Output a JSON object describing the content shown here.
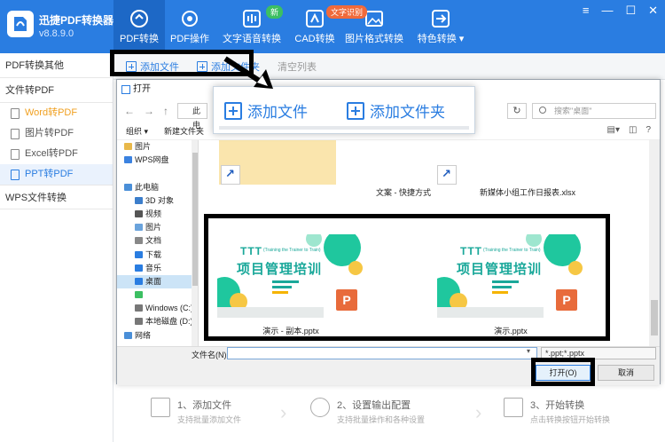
{
  "app": {
    "title": "迅捷PDF转换器",
    "version": "v8.8.9.0"
  },
  "nav": [
    {
      "label": "PDF转换",
      "icon": "refresh-icon"
    },
    {
      "label": "PDF操作",
      "icon": "gear-icon"
    },
    {
      "label": "文字语音转换",
      "icon": "soundwave-icon"
    },
    {
      "label": "CAD转换",
      "icon": "cad-icon"
    },
    {
      "label": "图片格式转换",
      "icon": "image-icon"
    },
    {
      "label": "特色转换",
      "icon": "special-convert-icon"
    }
  ],
  "badges": {
    "new": "新",
    "trial": "文字识别"
  },
  "sidebar": {
    "group1": "PDF转换其他",
    "group2": "文件转PDF",
    "items": [
      "Word转PDF",
      "图片转PDF",
      "Excel转PDF",
      "PPT转PDF"
    ],
    "group3": "WPS文件转换"
  },
  "toolbar": {
    "add_file": "添加文件",
    "add_folder": "添加文件夹",
    "clear": "清空列表"
  },
  "dialog": {
    "title": "打开",
    "path": "此电",
    "search_placeholder": "搜索\"桌面\"",
    "organize": "组织 ▾",
    "new_folder": "新建文件夹",
    "tree": [
      {
        "label": "图片",
        "indent": false,
        "color": "#e8b84a"
      },
      {
        "label": "WPS网盘",
        "indent": false,
        "color": "#3b82e0"
      },
      {
        "label": "",
        "indent": false,
        "color": ""
      },
      {
        "label": "此电脑",
        "indent": false,
        "color": "#4a8fd8"
      },
      {
        "label": "3D 对象",
        "indent": true,
        "color": "#3c7ecb"
      },
      {
        "label": "视频",
        "indent": true,
        "color": "#555"
      },
      {
        "label": "图片",
        "indent": true,
        "color": "#6aa3dc"
      },
      {
        "label": "文档",
        "indent": true,
        "color": "#888"
      },
      {
        "label": "下载",
        "indent": true,
        "color": "#2a7de1"
      },
      {
        "label": "音乐",
        "indent": true,
        "color": "#2a7de1"
      },
      {
        "label": "桌面",
        "indent": true,
        "color": "#2a7de1",
        "selected": true
      },
      {
        "label": "",
        "indent": true,
        "color": "#3cbf62"
      },
      {
        "label": "Windows (C:)",
        "indent": true,
        "color": "#777"
      },
      {
        "label": "本地磁盘 (D:)",
        "indent": true,
        "color": "#777"
      },
      {
        "label": "网络",
        "indent": false,
        "color": "#4a8fd8"
      }
    ],
    "files_top": [
      "文案 - 快捷方式",
      "新媒体小组工作日报表.xlsx"
    ],
    "files_ppt": [
      "演示 - 副本.pptx",
      "演示.pptx"
    ],
    "filename_label": "文件名(N):",
    "filename_value": "",
    "filter": "*.ppt;*.pptx",
    "open_btn": "打开(O)",
    "cancel_btn": "取消"
  },
  "thumb": {
    "ttt": "TTT",
    "subtitle": "(Training the Trainer to Train)",
    "main": "项目管理培训",
    "ppt_icon": "P"
  },
  "callout": {
    "add_file": "添加文件",
    "add_folder": "添加文件夹"
  },
  "steps": [
    {
      "title": "1、添加文件",
      "desc": "支持批量添加文件"
    },
    {
      "title": "2、设置输出配置",
      "desc": "支持批量操作和各种设置"
    },
    {
      "title": "3、开始转换",
      "desc": "点击转换按钮开始转换"
    }
  ],
  "colors": {
    "brand": "#2a7de1",
    "nav_active": "#1d68c6",
    "highlight": "#000000"
  }
}
